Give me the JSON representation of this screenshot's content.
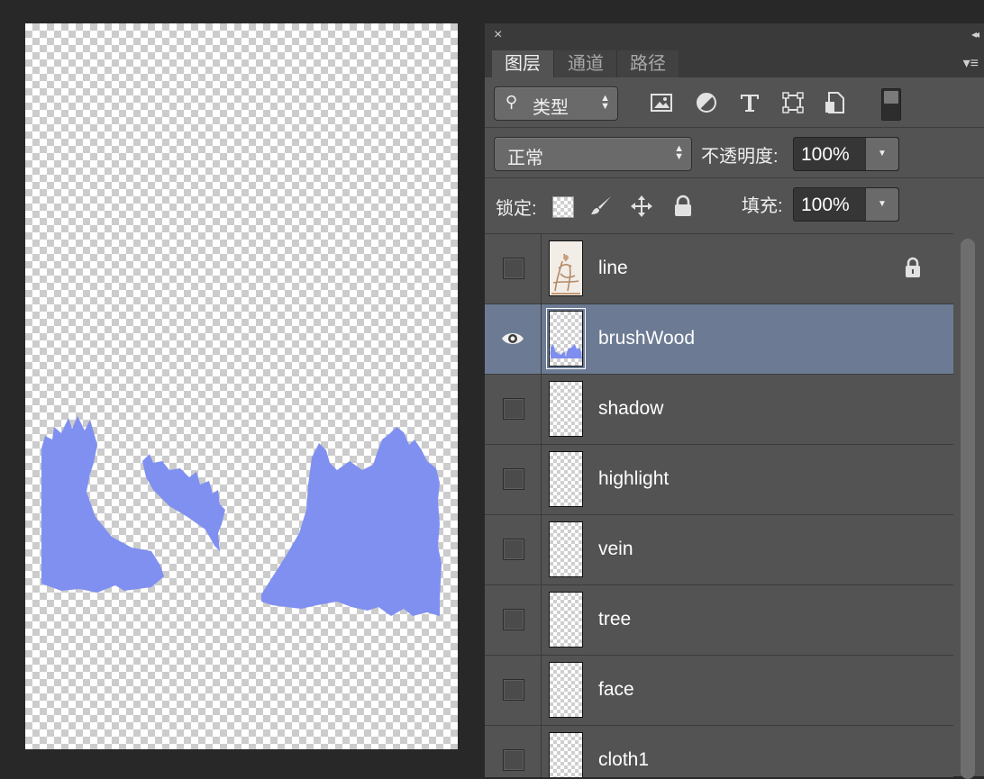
{
  "canvas": {
    "fill_color": "#8090f0"
  },
  "panel": {
    "close_glyph": "×",
    "collapse_glyph": "◂◂",
    "menu_glyph": "▾≡",
    "tabs": [
      {
        "label": "图层",
        "active": true
      },
      {
        "label": "通道",
        "active": false
      },
      {
        "label": "路径",
        "active": false
      }
    ],
    "filter": {
      "kind_label": "类型",
      "icons": [
        "image-icon",
        "adjustment-icon",
        "type-icon",
        "shape-icon",
        "smart-object-icon"
      ]
    },
    "blend": {
      "mode": "正常",
      "opacity_label": "不透明度:",
      "opacity_value": "100%"
    },
    "lock": {
      "label": "锁定:",
      "fill_label": "填充:",
      "fill_value": "100%"
    },
    "layers": [
      {
        "name": "line",
        "visible": false,
        "locked": true,
        "selected": false
      },
      {
        "name": "brushWood",
        "visible": true,
        "locked": false,
        "selected": true
      },
      {
        "name": "shadow",
        "visible": false,
        "locked": false,
        "selected": false
      },
      {
        "name": "highlight",
        "visible": false,
        "locked": false,
        "selected": false
      },
      {
        "name": "vein",
        "visible": false,
        "locked": false,
        "selected": false
      },
      {
        "name": "tree",
        "visible": false,
        "locked": false,
        "selected": false
      },
      {
        "name": "face",
        "visible": false,
        "locked": false,
        "selected": false
      },
      {
        "name": "cloth1",
        "visible": false,
        "locked": false,
        "selected": false
      }
    ]
  },
  "colors": {
    "selection": "#6c7b93",
    "panel_bg": "#535353"
  }
}
